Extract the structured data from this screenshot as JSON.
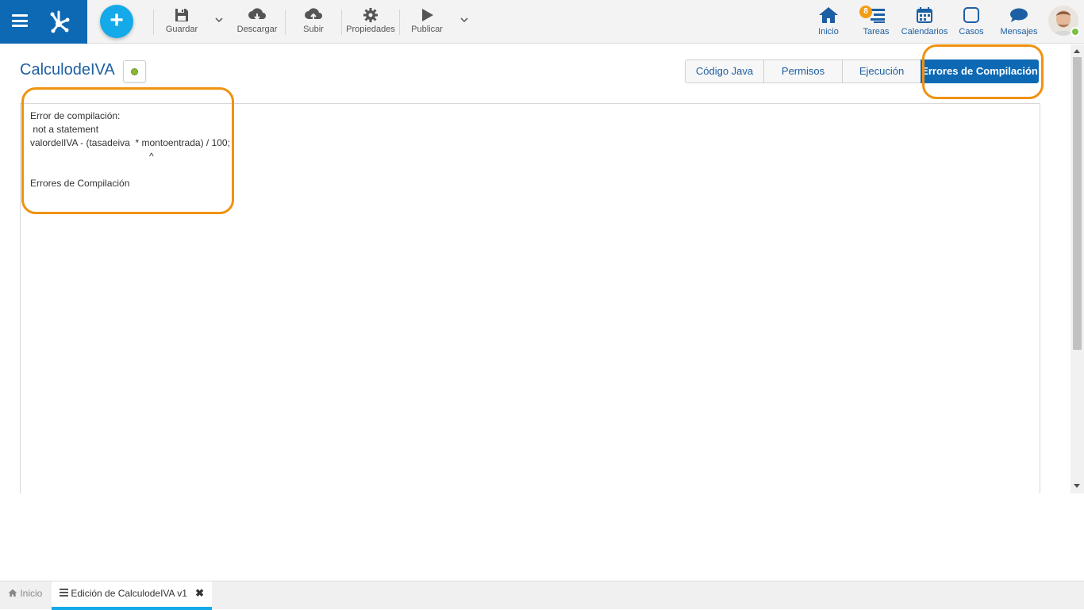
{
  "toolbar": {
    "save_label": "Guardar",
    "download_label": "Descargar",
    "upload_label": "Subir",
    "properties_label": "Propiedades",
    "publish_label": "Publicar",
    "add_symbol": "+"
  },
  "nav": {
    "home_label": "Inicio",
    "tasks_label": "Tareas",
    "tasks_badge": "8",
    "calendars_label": "Calendarios",
    "cases_label": "Casos",
    "messages_label": "Mensajes"
  },
  "page": {
    "title": "CalculodeIVA",
    "status_color": "#8ab832"
  },
  "tabs": [
    {
      "label": "Código Java",
      "active": false
    },
    {
      "label": "Permisos",
      "active": false
    },
    {
      "label": "Ejecución",
      "active": false
    },
    {
      "label": "Errores de Compilación",
      "active": true
    }
  ],
  "errors": {
    "line1": "Error de compilación:",
    "line2": " not a statement",
    "line3": "valordelIVA - (tasadeiva  * montoentrada) / 100;",
    "line4": "                                             ^",
    "line5": "Errores de Compilación"
  },
  "bottom_tabs": {
    "home_label": "Inicio",
    "edit_label": "Edición de CalculodeIVA v1",
    "close_symbol": "✖"
  },
  "colors": {
    "brand": "#0e69b4",
    "accent": "#14a9e8",
    "highlight": "#f0920f"
  }
}
